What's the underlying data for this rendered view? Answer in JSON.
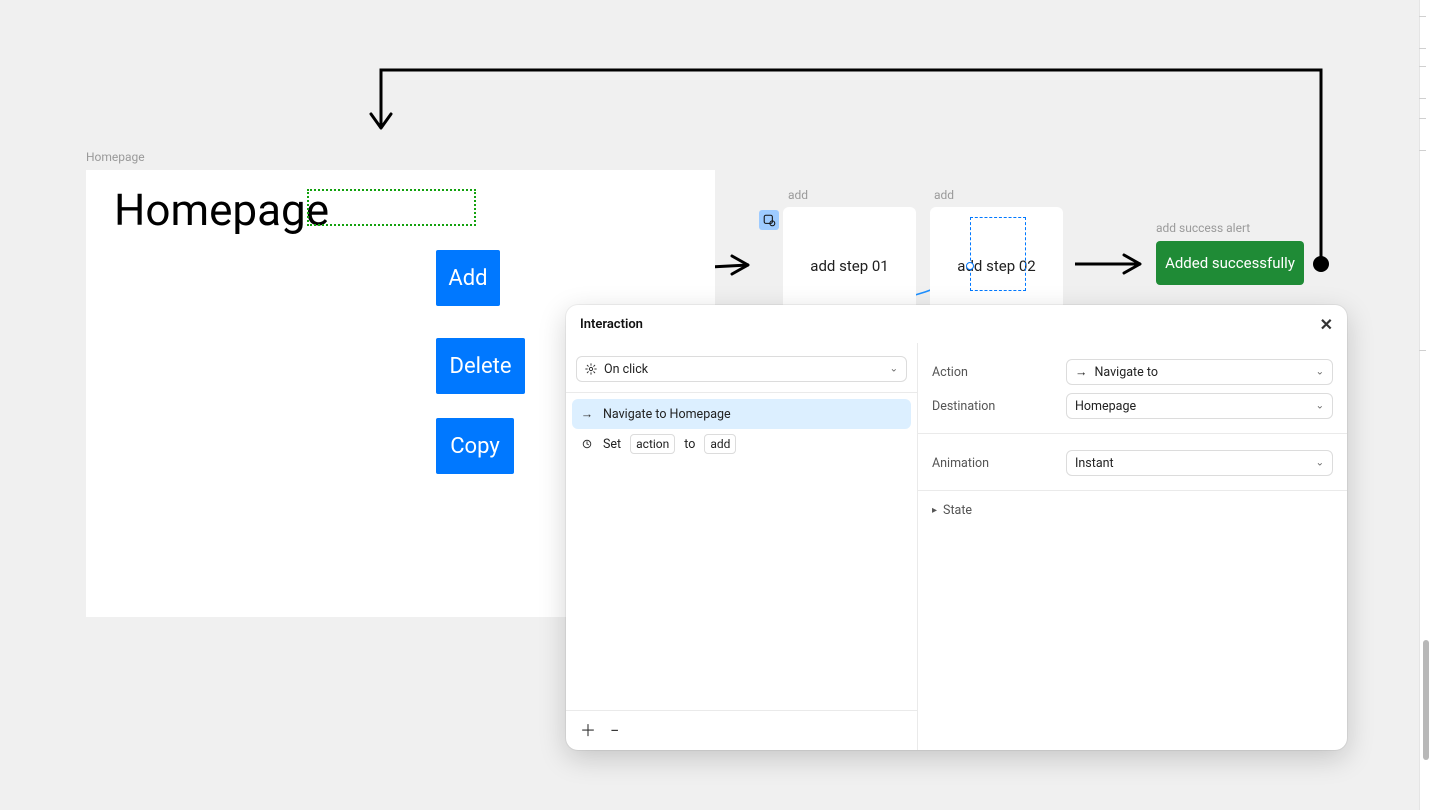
{
  "frames": {
    "homepage": {
      "label": "Homepage",
      "title": "Homepage"
    },
    "buttons": {
      "add": "Add",
      "delete": "Delete",
      "copy": "Copy"
    },
    "step1": {
      "label": "add",
      "text": "add step 01"
    },
    "step2": {
      "label": "add",
      "text": "add step 02"
    },
    "success": {
      "label": "add success alert",
      "text": "Added successfully"
    }
  },
  "interaction": {
    "title": "Interaction",
    "trigger": "On click",
    "actions": {
      "navigate": "Navigate to Homepage",
      "set_prefix": "Set",
      "set_var": "action",
      "set_mid": "to",
      "set_val": "add"
    },
    "props": {
      "action_label": "Action",
      "action_value": "Navigate to",
      "destination_label": "Destination",
      "destination_value": "Homepage",
      "animation_label": "Animation",
      "animation_value": "Instant"
    },
    "state_label": "State"
  }
}
